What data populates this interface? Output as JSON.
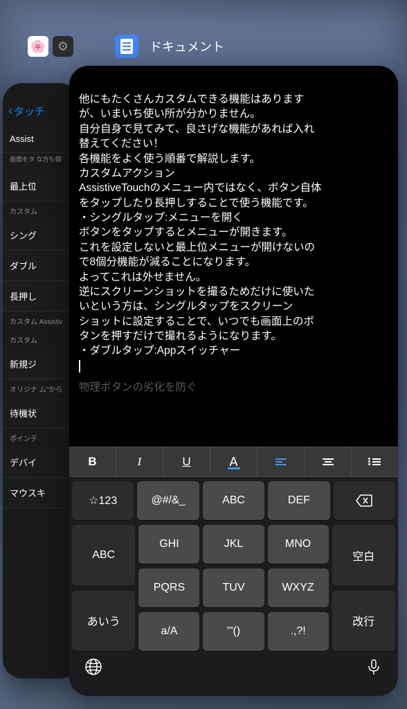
{
  "app": {
    "label": "ドキュメント"
  },
  "back_card": {
    "back_link": "タッチ",
    "items": [
      "Assist",
      "最上位",
      "シング",
      "ダブル",
      "長押し",
      "新規ジ",
      "待機状",
      "デバイ",
      "マウスキ"
    ],
    "desc1": "画面をタ\nな方も個",
    "sections": [
      "カスタム",
      "カスタム\nAssistiv",
      "カスタム",
      "オリジナ\nム\"から",
      "ポインテ"
    ]
  },
  "document": {
    "lines": [
      "他にもたくさんカスタムできる機能はあります",
      "が、いまいち使い所が分かりません。",
      "自分自身で見てみて、良さげな機能があれば入れ",
      "替えてください！",
      "各機能をよく使う順番で解説します。",
      "カスタムアクション",
      "AssistiveTouchのメニュー内ではなく、ボタン自体",
      "をタップしたり長押しすることで使う機能です。",
      "・シングルタップ:メニューを開く",
      "ボタンをタップするとメニューが開きます。",
      "これを設定しないと最上位メニューが開けないの",
      "で8個分機能が減ることになります。",
      "よってこれは外せません。",
      "逆にスクリーンショットを撮るためだけに使いた",
      "いという方は、シングルタップをスクリーン",
      "ショットに設定することで、いつでも画面上のボ",
      "タンを押すだけで撮れるようになります。",
      "",
      "・ダブルタップ:Appスイッチャー"
    ],
    "faded": "物理ボタンの劣化を防ぐ"
  },
  "toolbar": {
    "bold": "B",
    "italic": "I",
    "underline": "U",
    "color": "A"
  },
  "keyboard": {
    "r1": [
      "☆123",
      "@#/&_",
      "ABC",
      "DEF"
    ],
    "r2_left": "ABC",
    "r2": [
      "GHI",
      "JKL",
      "MNO"
    ],
    "r2_right": "空白",
    "r3_left": "あいう",
    "r3": [
      "PQRS",
      "TUV",
      "WXYZ"
    ],
    "r3_right": "改行",
    "r4": [
      "a/A",
      "'\"()",
      ".,?!"
    ]
  }
}
